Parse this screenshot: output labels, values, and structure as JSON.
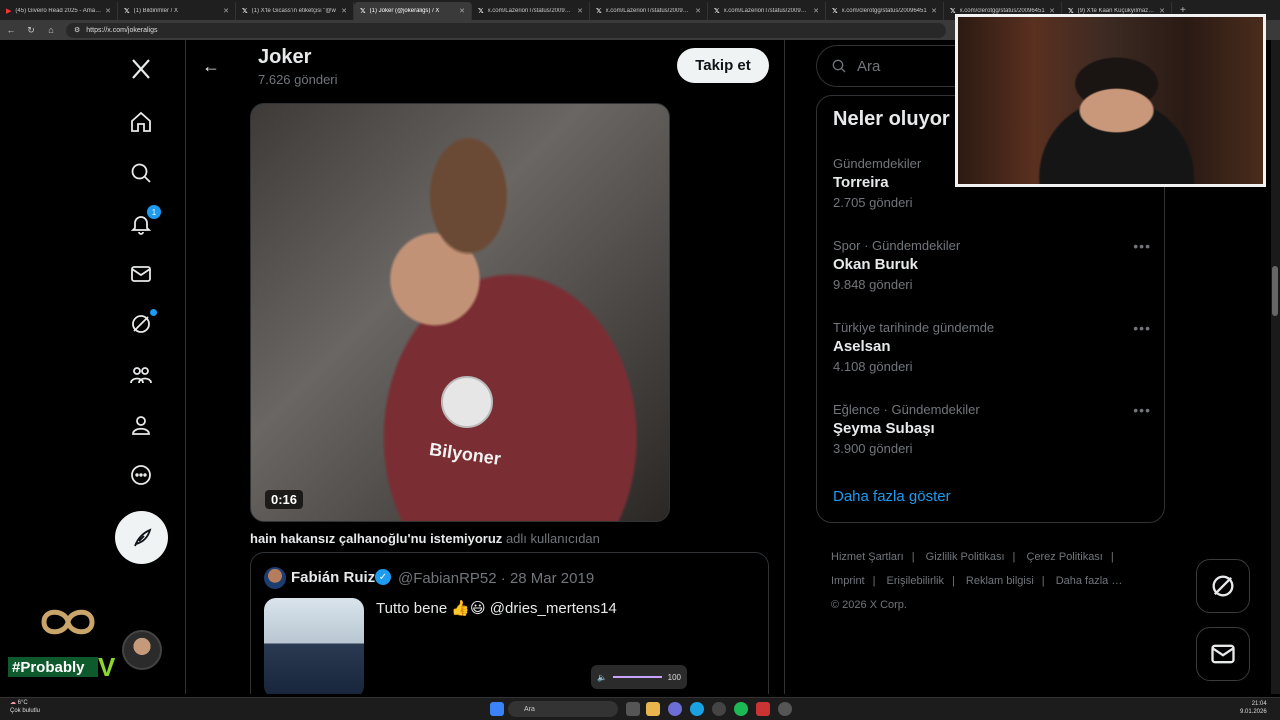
{
  "browser": {
    "tabs": [
      {
        "icon": "youtube-icon",
        "label": "(45) Giveiro Read 2025 - Amazing"
      },
      {
        "icon": "x-icon",
        "label": "(1) Bildirimler / X"
      },
      {
        "icon": "x-icon",
        "label": "(1) X'te Gicass'ın etiketçisi \"@w"
      },
      {
        "icon": "x-icon",
        "label": "(1) Joker (@jokeraligs) / X"
      },
      {
        "icon": "x-icon",
        "label": "x.com/LazerionT/status/2009640"
      },
      {
        "icon": "x-icon",
        "label": "x.com/LazerionT/status/2009640"
      },
      {
        "icon": "x-icon",
        "label": "x.com/LazerionT/status/2009641"
      },
      {
        "icon": "x-icon",
        "label": "x.com/clerotgg/status/20096451"
      },
      {
        "icon": "x-icon",
        "label": "x.com/clerotgg/status/20096451"
      },
      {
        "icon": "x-icon",
        "label": "(9) X'te Kaan Küçükyılmaz: \"Hasta"
      }
    ],
    "active_tab_index": 3,
    "new_tab": "+",
    "url": "https://x.com/jokeraligs"
  },
  "nav": {
    "notification_count": "1"
  },
  "profile": {
    "name": "Joker",
    "post_count": "7.626 gönderi",
    "follow_label": "Takip et"
  },
  "video": {
    "duration": "0:16",
    "jersey_text": "Bilyoner"
  },
  "caption": {
    "user": "hain hakansız çalhanoğlu'nu istemiyoruz",
    "suffix": "adlı kullanıcıdan"
  },
  "quote": {
    "name": "Fabián Ruiz",
    "handle": "@FabianRP52 · 28 Mar 2019",
    "text": "Tutto bene 👍😃 @dries_mertens14"
  },
  "volume": {
    "value": "100"
  },
  "search": {
    "placeholder": "Ara"
  },
  "trends": {
    "title": "Neler oluyor",
    "items": [
      {
        "context": "Gündemdekiler",
        "name": "Torreira",
        "count": "2.705 gönderi"
      },
      {
        "context": "Spor · Gündemdekiler",
        "name": "Okan Buruk",
        "count": "9.848 gönderi"
      },
      {
        "context": "Türkiye tarihinde gündemde",
        "name": "Aselsan",
        "count": "4.108 gönderi"
      },
      {
        "context": "Eğlence · Gündemdekiler",
        "name": "Şeyma Subaşı",
        "count": "3.900 gönderi"
      }
    ],
    "show_more": "Daha fazla göster"
  },
  "footer": {
    "links": [
      "Hizmet Şartları",
      "Gizlilik Politikası",
      "Çerez Politikası",
      "Imprint",
      "Erişilebilirlik",
      "Reklam bilgisi",
      "Daha fazla …"
    ],
    "copyright": "© 2026 X Corp."
  },
  "overlay": {
    "hashtag": "#Probably"
  },
  "taskbar": {
    "weather_temp": "6°C",
    "weather_desc": "Çok bulutlu",
    "search_label": "Ara",
    "time": "21:04",
    "date": "9.01.2026"
  }
}
